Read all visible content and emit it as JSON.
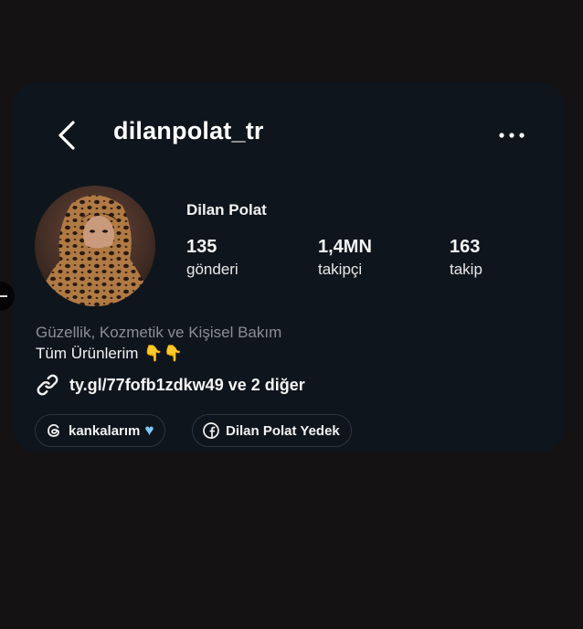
{
  "header": {
    "username": "dilanpolat_tr"
  },
  "profile": {
    "display_name": "Dilan Polat",
    "stats": [
      {
        "value": "135",
        "label": "gönderi"
      },
      {
        "value": "1,4MN",
        "label": "takipçi"
      },
      {
        "value": "163",
        "label": "takip"
      }
    ],
    "category": "Güzellik, Kozmetik ve Kişisel Bakım",
    "bio": "Tüm Ürünlerim",
    "bio_emoji": "👇👇",
    "link": "ty.gl/77fofb1zdkw49 ve 2 diğer"
  },
  "chips": [
    {
      "label": "kankalarım",
      "icon": "threads-icon"
    },
    {
      "label": "Dilan Polat Yedek",
      "icon": "facebook-icon"
    }
  ],
  "colors": {
    "background": "#141213",
    "card": "#0f151c",
    "muted_text": "#8a8f97",
    "chip_border": "#2e353e",
    "heart": "#7ec8f5"
  }
}
